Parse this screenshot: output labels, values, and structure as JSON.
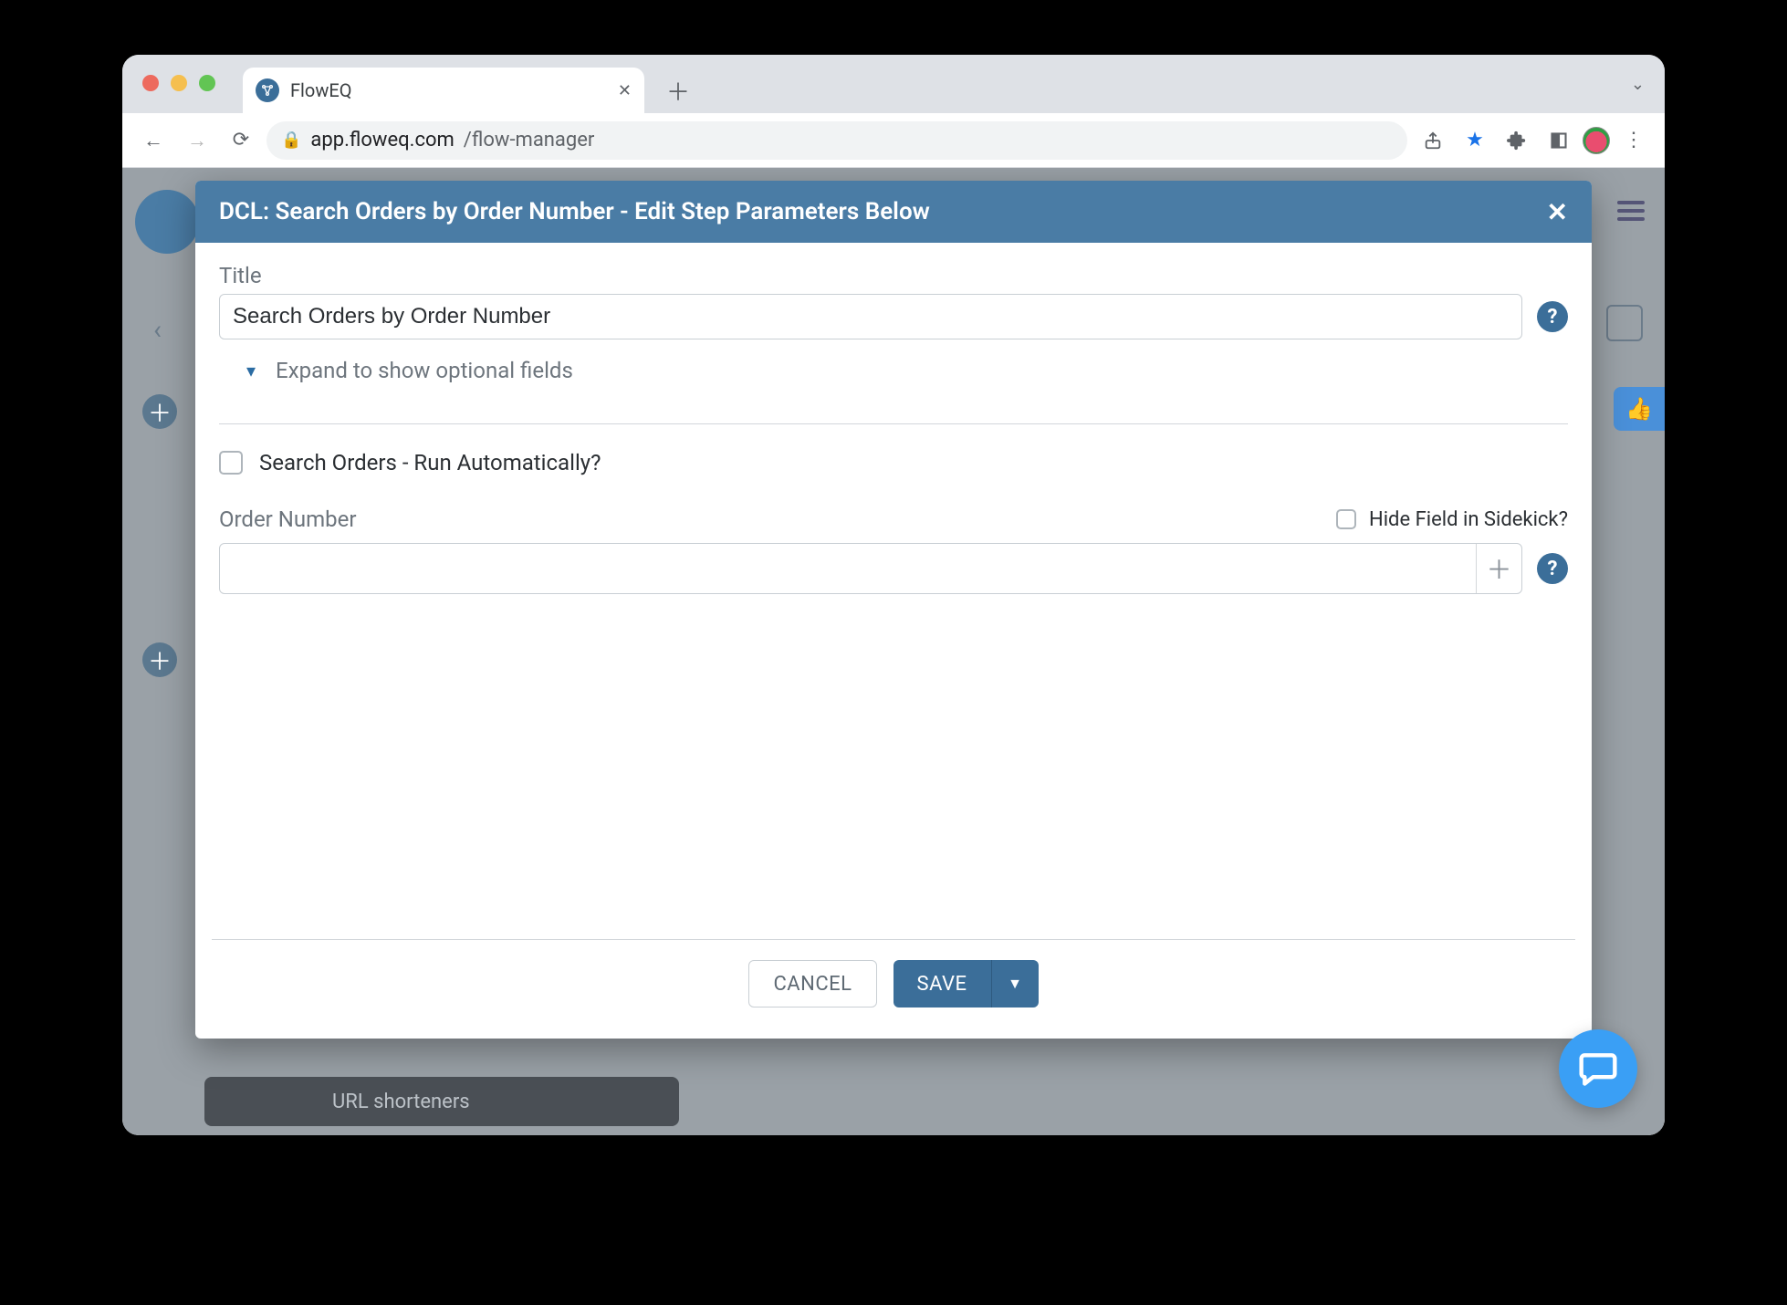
{
  "browser": {
    "tab_title": "FlowEQ",
    "url_domain": "app.floweq.com",
    "url_path": "/flow-manager"
  },
  "bg": {
    "url_shortener_label": "URL shorteners"
  },
  "modal": {
    "header_title": "DCL: Search Orders by Order Number - Edit Step Parameters Below",
    "title_label": "Title",
    "title_value": "Search Orders by Order Number",
    "expand_label": "Expand to show optional fields",
    "run_auto_label": "Search Orders - Run Automatically?",
    "order_number_label": "Order Number",
    "hide_field_label": "Hide Field in Sidekick?",
    "order_number_value": "",
    "cancel_label": "CANCEL",
    "save_label": "SAVE"
  }
}
